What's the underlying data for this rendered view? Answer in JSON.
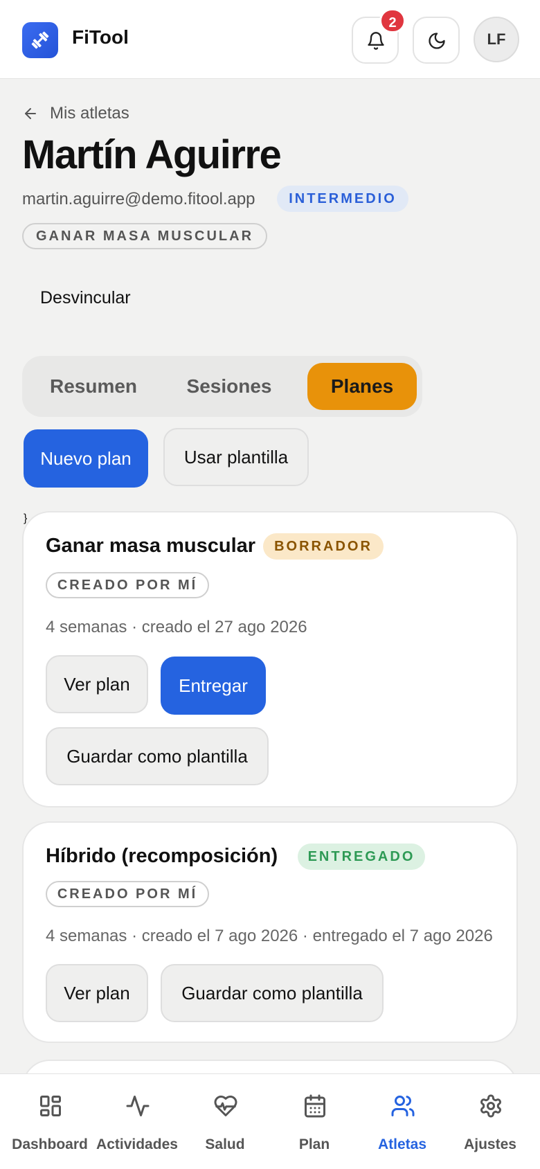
{
  "app": {
    "name": "FiTool"
  },
  "header": {
    "notification_count": "2",
    "user_initials": "LF"
  },
  "breadcrumb": {
    "back_label": "Mis atletas"
  },
  "athlete": {
    "name": "Martín Aguirre",
    "email": "martin.aguirre@demo.fitool.app",
    "level": "INTERMEDIO",
    "goal": "GANAR MASA MUSCULAR",
    "unlink_label": "Desvincular"
  },
  "tabs": [
    {
      "label": "Resumen",
      "active": false
    },
    {
      "label": "Sesiones",
      "active": false
    },
    {
      "label": "Planes",
      "active": true
    }
  ],
  "actions": {
    "new_plan": "Nuevo plan",
    "use_template": "Usar plantilla"
  },
  "plans": [
    {
      "title": "Ganar masa muscular",
      "status": "BORRADOR",
      "creator": "CREADO POR MÍ",
      "meta": "4 semanas · creado el 27 ago 2026",
      "buttons": {
        "view": "Ver plan",
        "deliver": "Entregar",
        "save_template": "Guardar como plantilla"
      }
    },
    {
      "title": "Híbrido (recomposición)",
      "status": "ENTREGADO",
      "creator": "CREADO POR MÍ",
      "meta": "4 semanas · creado el 7 ago 2026 · entregado el 7 ago 2026",
      "buttons": {
        "view": "Ver plan",
        "save_template": "Guardar como plantilla"
      }
    }
  ],
  "nav": [
    {
      "label": "Dashboard",
      "icon": "dashboard-icon",
      "active": false
    },
    {
      "label": "Actividades",
      "icon": "activity-icon",
      "active": false
    },
    {
      "label": "Salud",
      "icon": "heart-icon",
      "active": false
    },
    {
      "label": "Plan",
      "icon": "calendar-icon",
      "active": false
    },
    {
      "label": "Atletas",
      "icon": "users-icon",
      "active": true
    },
    {
      "label": "Ajustes",
      "icon": "gear-icon",
      "active": false
    }
  ],
  "colors": {
    "primary": "#2563e0",
    "accent": "#e8920a",
    "notification": "#e0363f",
    "draft_bg": "#fbe8c8",
    "delivered_bg": "#dcf1e2"
  }
}
